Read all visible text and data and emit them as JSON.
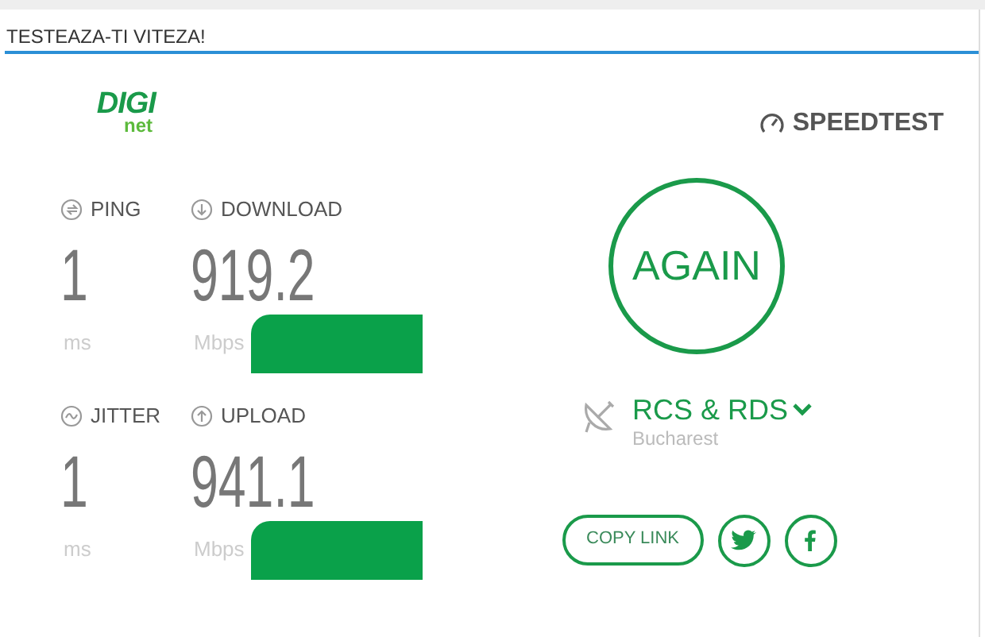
{
  "header": {
    "title": "TESTEAZA-TI VITEZA!"
  },
  "logo": {
    "brand": "DIGI",
    "sub": "net"
  },
  "speedtest": {
    "label": "SPEEDTEST"
  },
  "metrics": [
    {
      "kind": "ping",
      "label": "PING",
      "value": "1",
      "unit": "ms",
      "redacted": false
    },
    {
      "kind": "download",
      "label": "DOWNLOAD",
      "value": "919.2",
      "unit": "Mbps",
      "redacted": true
    },
    {
      "kind": "jitter",
      "label": "JITTER",
      "value": "1",
      "unit": "ms",
      "redacted": false
    },
    {
      "kind": "upload",
      "label": "UPLOAD",
      "value": "941.1",
      "unit": "Mbps",
      "redacted": true
    }
  ],
  "again_button": {
    "label": "AGAIN"
  },
  "server": {
    "name": "RCS & RDS",
    "location": "Bucharest"
  },
  "share": {
    "copy_link": "COPY LINK"
  }
}
